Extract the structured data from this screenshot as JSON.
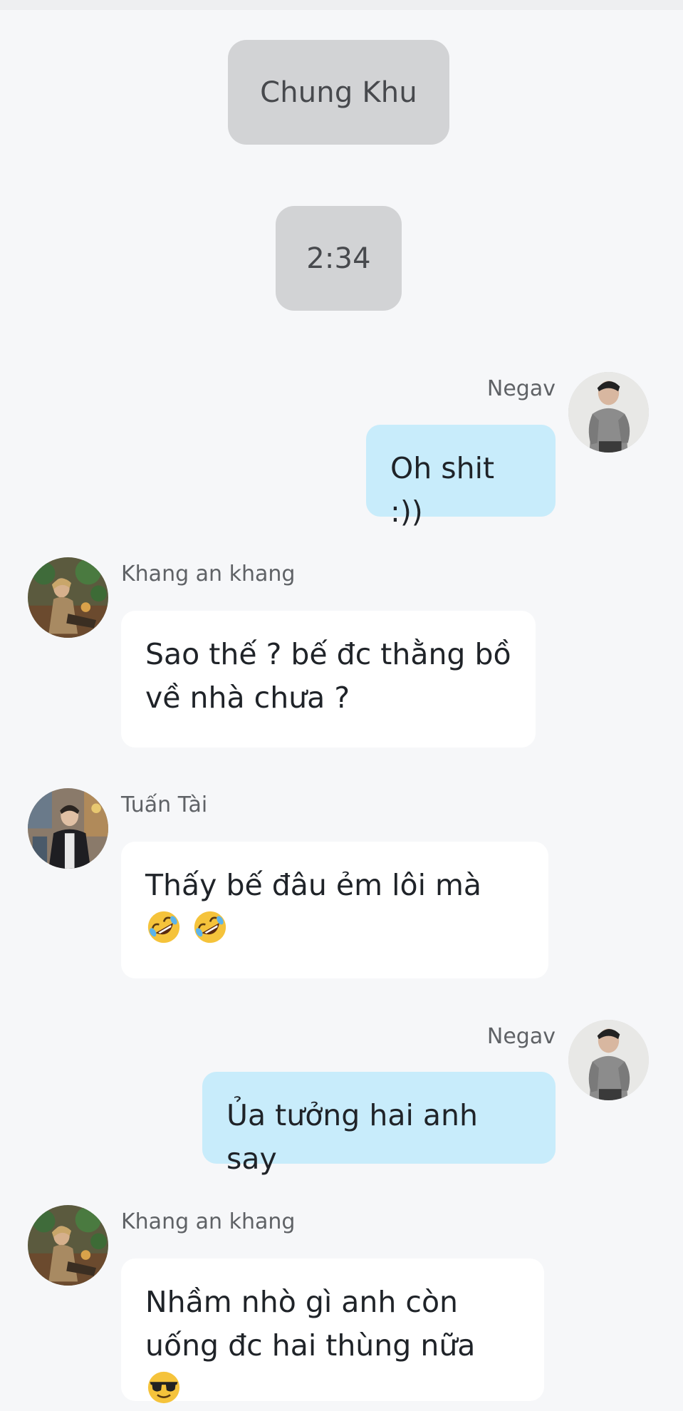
{
  "system_labels": {
    "group": "Chung Khu",
    "time": "2:34"
  },
  "messages": [
    {
      "sender": "Negav",
      "side": "right",
      "text": "Oh shit :))"
    },
    {
      "sender": "Khang an khang",
      "side": "left",
      "text": "Sao thế ? bế đc thằng bồ về nhà chưa ?"
    },
    {
      "sender": "Tuấn Tài",
      "side": "left",
      "text": "Thấy bế đâu ẻm lôi mà",
      "emojis": [
        "rolling-on-floor-laughing",
        "rolling-on-floor-laughing"
      ]
    },
    {
      "sender": "Negav",
      "side": "right",
      "text": "Ủa tưởng hai anh say"
    },
    {
      "sender": "Khang an khang",
      "side": "left",
      "text_line1": "Nhầm nhò gì anh còn",
      "text_line2": "uống đc hai thùng nữa",
      "emojis": [
        "smiling-face-with-sunglasses"
      ]
    }
  ],
  "colors": {
    "background": "#f6f7f9",
    "my_bubble": "#c8ecfb",
    "other_bubble": "#ffffff",
    "system_pill": "#d2d3d5"
  }
}
